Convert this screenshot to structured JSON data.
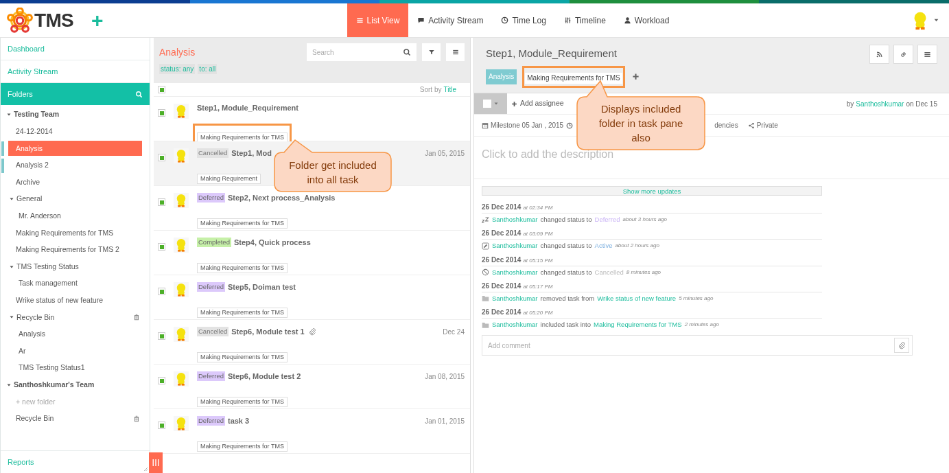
{
  "header": {
    "logo": "TMS",
    "add": "+",
    "nav": [
      {
        "label": "List View",
        "kind": "list",
        "selected": true
      },
      {
        "label": "Activity Stream",
        "kind": "chat",
        "selected": false
      },
      {
        "label": "Time Log",
        "kind": "clock",
        "selected": false
      },
      {
        "label": "Timeline",
        "kind": "sliders",
        "selected": false
      },
      {
        "label": "Workload",
        "kind": "user",
        "selected": false
      }
    ]
  },
  "sidebar": {
    "links": [
      "Dashboard",
      "Activity Stream"
    ],
    "folders_title": "Folders",
    "reports": "Reports",
    "tree": [
      {
        "label": "Testing Team",
        "kind": "team",
        "expanded": true,
        "children": [
          {
            "label": "24-12-2014",
            "selected": false,
            "marked": false
          },
          {
            "label": "Analysis",
            "selected": true,
            "marked": true
          },
          {
            "label": "Analysis 2",
            "selected": false,
            "marked": true
          },
          {
            "label": "Archive",
            "selected": false,
            "marked": false
          },
          {
            "label": "General",
            "expanded": true,
            "selected": false,
            "marked": false,
            "children": [
              {
                "label": "Mr. Anderson",
                "selected": false,
                "marked": false
              }
            ]
          },
          {
            "label": "Making Requirements for TMS",
            "selected": false,
            "marked": false
          },
          {
            "label": "Making Requirements for TMS 2",
            "selected": false,
            "marked": false
          },
          {
            "label": "TMS Testing Status",
            "expanded": true,
            "selected": false,
            "marked": false,
            "children": [
              {
                "label": "Task management",
                "selected": false,
                "marked": false
              }
            ]
          },
          {
            "label": "Wrike status of new feature",
            "selected": false,
            "marked": false
          },
          {
            "label": "Recycle Bin",
            "kind": "bin",
            "expanded": true,
            "selected": false,
            "marked": false,
            "children": [
              {
                "label": "Analysis",
                "selected": false,
                "marked": false
              },
              {
                "label": "Ar",
                "selected": false,
                "marked": false
              },
              {
                "label": "TMS Testing Status1",
                "selected": false,
                "marked": false
              }
            ]
          }
        ]
      },
      {
        "label": "Santhoshkumar's Team",
        "kind": "team",
        "expanded": true,
        "children": [
          {
            "label": "+ new folder",
            "kind": "new",
            "selected": false,
            "marked": false
          },
          {
            "label": "Recycle Bin",
            "kind": "bin",
            "selected": false,
            "marked": false
          }
        ]
      }
    ]
  },
  "list": {
    "title": "Analysis",
    "search": {
      "placeholder": "Search"
    },
    "filters": [
      "status: any",
      "to: all"
    ],
    "sort_label": "Sort by",
    "sort_value": "Title",
    "select_all": true,
    "tasks": [
      {
        "title": "Step1, Module_Requirement",
        "folder": "Making Requirements for TMS",
        "checked": true,
        "selected": false,
        "highlighted": true
      },
      {
        "status": "Cancelled",
        "kind": "cancelled",
        "title": "Step1, Mod",
        "date": "Jan 05, 2015",
        "folder": "Making Requirement",
        "checked": true,
        "selected": true,
        "highlighted": false
      },
      {
        "status": "Deferred",
        "kind": "deferred",
        "title": "Step2, Next process_Analysis",
        "folder": "Making Requirements for TMS",
        "checked": true,
        "selected": false,
        "highlighted": false
      },
      {
        "status": "Completed",
        "kind": "completed",
        "title": "Step4, Quick process",
        "folder": "Making Requirements for TMS",
        "checked": true,
        "selected": false,
        "highlighted": false
      },
      {
        "status": "Deferred",
        "kind": "deferred",
        "title": "Step5, Doiman test",
        "folder": "Making Requirements for TMS",
        "checked": true,
        "selected": false,
        "highlighted": false
      },
      {
        "status": "Cancelled",
        "kind": "cancelled",
        "title": "Step6, Module test 1",
        "attachment": true,
        "date": "Dec 24",
        "folder": "Making Requirements for TMS",
        "checked": true,
        "selected": false,
        "highlighted": false
      },
      {
        "status": "Deferred",
        "kind": "deferred",
        "title": "Step6, Module test 2",
        "date": "Jan 08, 2015",
        "folder": "Making Requirements for TMS",
        "checked": true,
        "selected": false,
        "highlighted": false
      },
      {
        "status": "Deferred",
        "kind": "deferred",
        "title": "task 3",
        "date": "Jan 01, 2015",
        "folder": "Making Requirements for TMS",
        "checked": true,
        "selected": false,
        "highlighted": false
      }
    ]
  },
  "task": {
    "title": "Step1, Module_Requirement",
    "folders": [
      {
        "label": "Analysis",
        "kind": "primary"
      },
      {
        "label": "Making Requirements for TMS",
        "kind": "included"
      }
    ],
    "add_assignee": "Add assignee",
    "by": "by",
    "author": "Santhoshkumar",
    "on": "on Dec 15",
    "meta": [
      {
        "label": "Milestone 05 Jan , 2015",
        "kind": "calendar"
      },
      {
        "kind": "clock"
      },
      {
        "label": "dencies"
      },
      {
        "label": "Private",
        "kind": "share"
      }
    ],
    "description": "Click to add the description",
    "show_more": "Show more updates",
    "updates": [
      {
        "date": "26 Dec 2014",
        "time": "at 02:34 PM",
        "kind": "sleep",
        "user": "Santhoshkumar",
        "action": "changed status to",
        "target": "Deferred",
        "ago": "about 3 hours ago"
      },
      {
        "date": "26 Dec 2014",
        "time": "at 03:09 PM",
        "kind": "edit",
        "user": "Santhoshkumar",
        "action": "changed status to",
        "target": "Active",
        "ago": "about 2 hours ago"
      },
      {
        "date": "26 Dec 2014",
        "time": "at 05:15 PM",
        "kind": "ban",
        "user": "Santhoshkumar",
        "action": "changed status to",
        "target": "Cancelled",
        "ago": "8 minutes ago"
      },
      {
        "date": "26 Dec 2014",
        "time": "at 05:17 PM",
        "kind": "folder",
        "user": "Santhoshkumar",
        "action": "removed task from",
        "target": "Wrike status of new feature",
        "ago": "5 minutes ago"
      },
      {
        "date": "26 Dec 2014",
        "time": "at 05:20 PM",
        "kind": "folder",
        "user": "Santhoshkumar",
        "action": "included task into",
        "target": "Making Requirements for TMS",
        "ago": "2 minutes ago"
      }
    ],
    "comment": {
      "placeholder": "Add comment"
    }
  },
  "callouts": [
    "Folder get included into all task",
    "Displays included folder in task pane also"
  ]
}
